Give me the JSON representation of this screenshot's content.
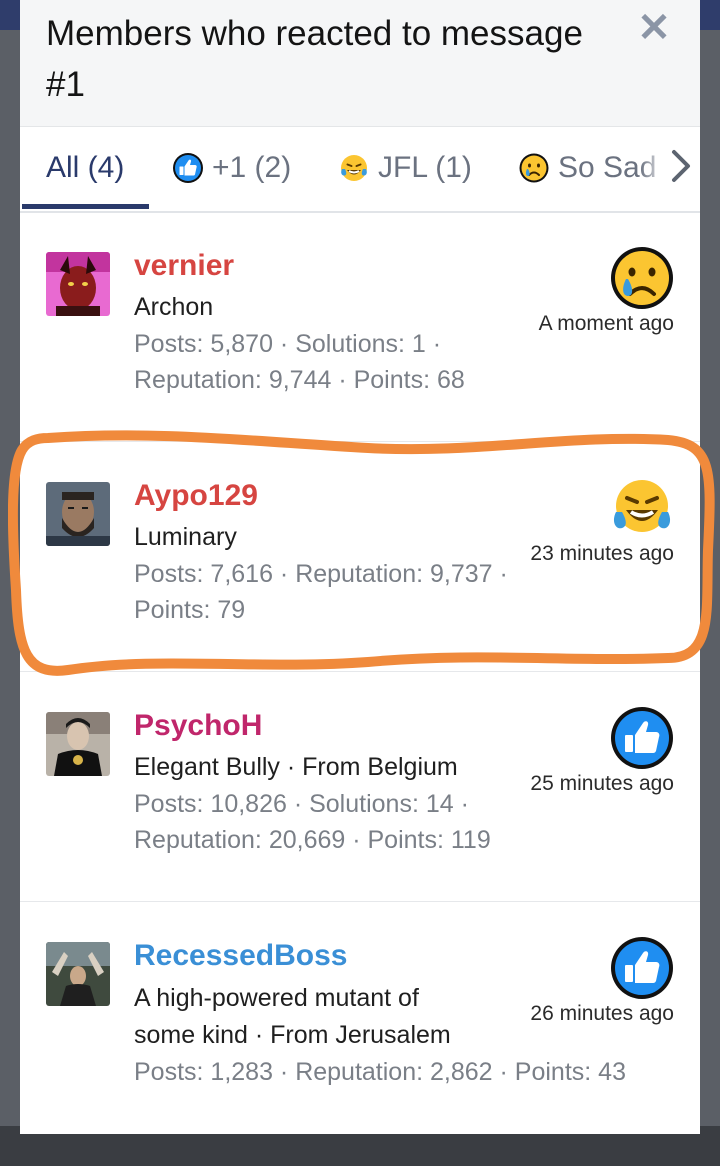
{
  "modal": {
    "title": "Members who reacted to message #1"
  },
  "tabs": [
    {
      "label": "All (4)",
      "icon": ""
    },
    {
      "label": "+1 (2)",
      "icon": "thumbs-up-icon"
    },
    {
      "label": "JFL (1)",
      "icon": "laughing-emoji-icon"
    },
    {
      "label": "So Sad",
      "icon": "sad-emoji-icon"
    }
  ],
  "members": [
    {
      "name": "vernier",
      "title": "Archon",
      "stats": "Posts: 5,870 · Solutions: 1 · Reputation: 9,744 · Points: 68",
      "time": "A moment ago",
      "reaction": "sad-emoji-icon",
      "name_color": "#d64541"
    },
    {
      "name": "Aypo129",
      "title": "Luminary",
      "stats": "Posts: 7,616 · Reputation: 9,737 · Points: 79",
      "time": "23 minutes ago",
      "reaction": "laughing-emoji-icon",
      "name_color": "#d64541"
    },
    {
      "name": "PsychoH",
      "title": "Elegant Bully · From Belgium",
      "stats": "Posts: 10,826 · Solutions: 14 · Reputation: 20,669 · Points: 119",
      "time": "25 minutes ago",
      "reaction": "thumbs-up-icon",
      "name_color": "#c0266b"
    },
    {
      "name": "RecessedBoss",
      "title": "A high-powered mutant of some kind · From Jerusalem",
      "stats": "Posts: 1,283 · Reputation: 2,862 · Points: 43",
      "time": "26 minutes ago",
      "reaction": "thumbs-up-icon",
      "name_color": "#3a8fd6"
    }
  ],
  "colors": {
    "accent": "#2a3a6b",
    "highlight": "#f08a3c"
  }
}
